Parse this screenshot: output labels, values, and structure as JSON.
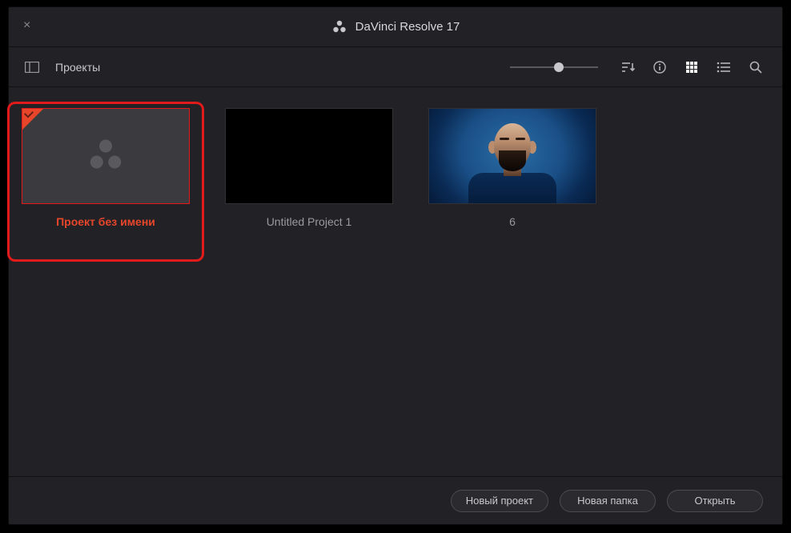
{
  "window": {
    "title": "DaVinci Resolve 17"
  },
  "toolbar": {
    "breadcrumb": "Проекты"
  },
  "projects": [
    {
      "name": "Проект без имени",
      "selected": true,
      "kind": "blank"
    },
    {
      "name": "Untitled Project 1",
      "selected": false,
      "kind": "black"
    },
    {
      "name": "6",
      "selected": false,
      "kind": "portrait"
    }
  ],
  "footer": {
    "new_project": "Новый проект",
    "new_folder": "Новая папка",
    "open": "Открыть"
  }
}
